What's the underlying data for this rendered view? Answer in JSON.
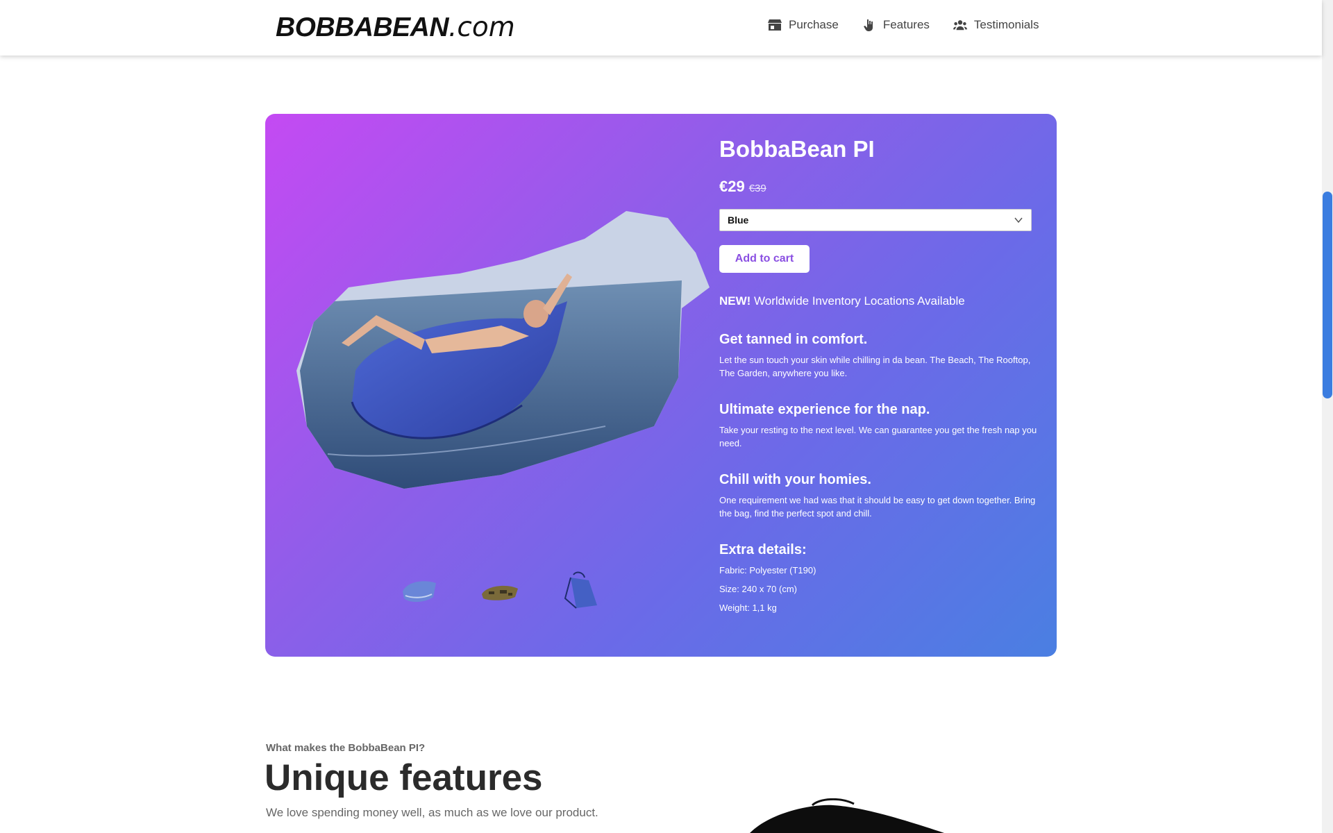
{
  "header": {
    "logo_brand": "BOBBABEAN",
    "logo_tld": ".com",
    "nav": [
      {
        "label": "Purchase",
        "icon": "store-icon"
      },
      {
        "label": "Features",
        "icon": "hand-icon"
      },
      {
        "label": "Testimonials",
        "icon": "users-icon"
      }
    ]
  },
  "product": {
    "title": "BobbaBean PI",
    "price": "€29",
    "old_price": "€39",
    "color_select": {
      "selected": "Blue"
    },
    "add_to_cart": "Add to cart",
    "notice_bold": "NEW!",
    "notice_text": " Worldwide Inventory Locations Available",
    "features": [
      {
        "heading": "Get tanned in comfort.",
        "text": "Let the sun touch your skin while chilling in da bean. The Beach, The Rooftop, The Garden, anywhere you like."
      },
      {
        "heading": "Ultimate experience for the nap.",
        "text": "Take your resting to the next level. We can guarantee you get the fresh nap you need."
      },
      {
        "heading": "Chill with your homies.",
        "text": "One requirement we had was that it should be easy to get down together. Bring the bag, find the perfect spot and chill."
      }
    ],
    "details_heading": "Extra details:",
    "details": [
      "Fabric: Polyester (T190)",
      "Size: 240 x 70 (cm)",
      "Weight: 1,1 kg"
    ]
  },
  "features_section": {
    "eyebrow": "What makes the BobbaBean PI?",
    "heading": "Unique features",
    "subtext": "We love spending money well, as much as we love our product."
  },
  "colors": {
    "gradient_start": "#c44af3",
    "gradient_end": "#4a7fe2",
    "button_text": "#8a4fe2",
    "scroll_thumb": "#3b7de0"
  }
}
